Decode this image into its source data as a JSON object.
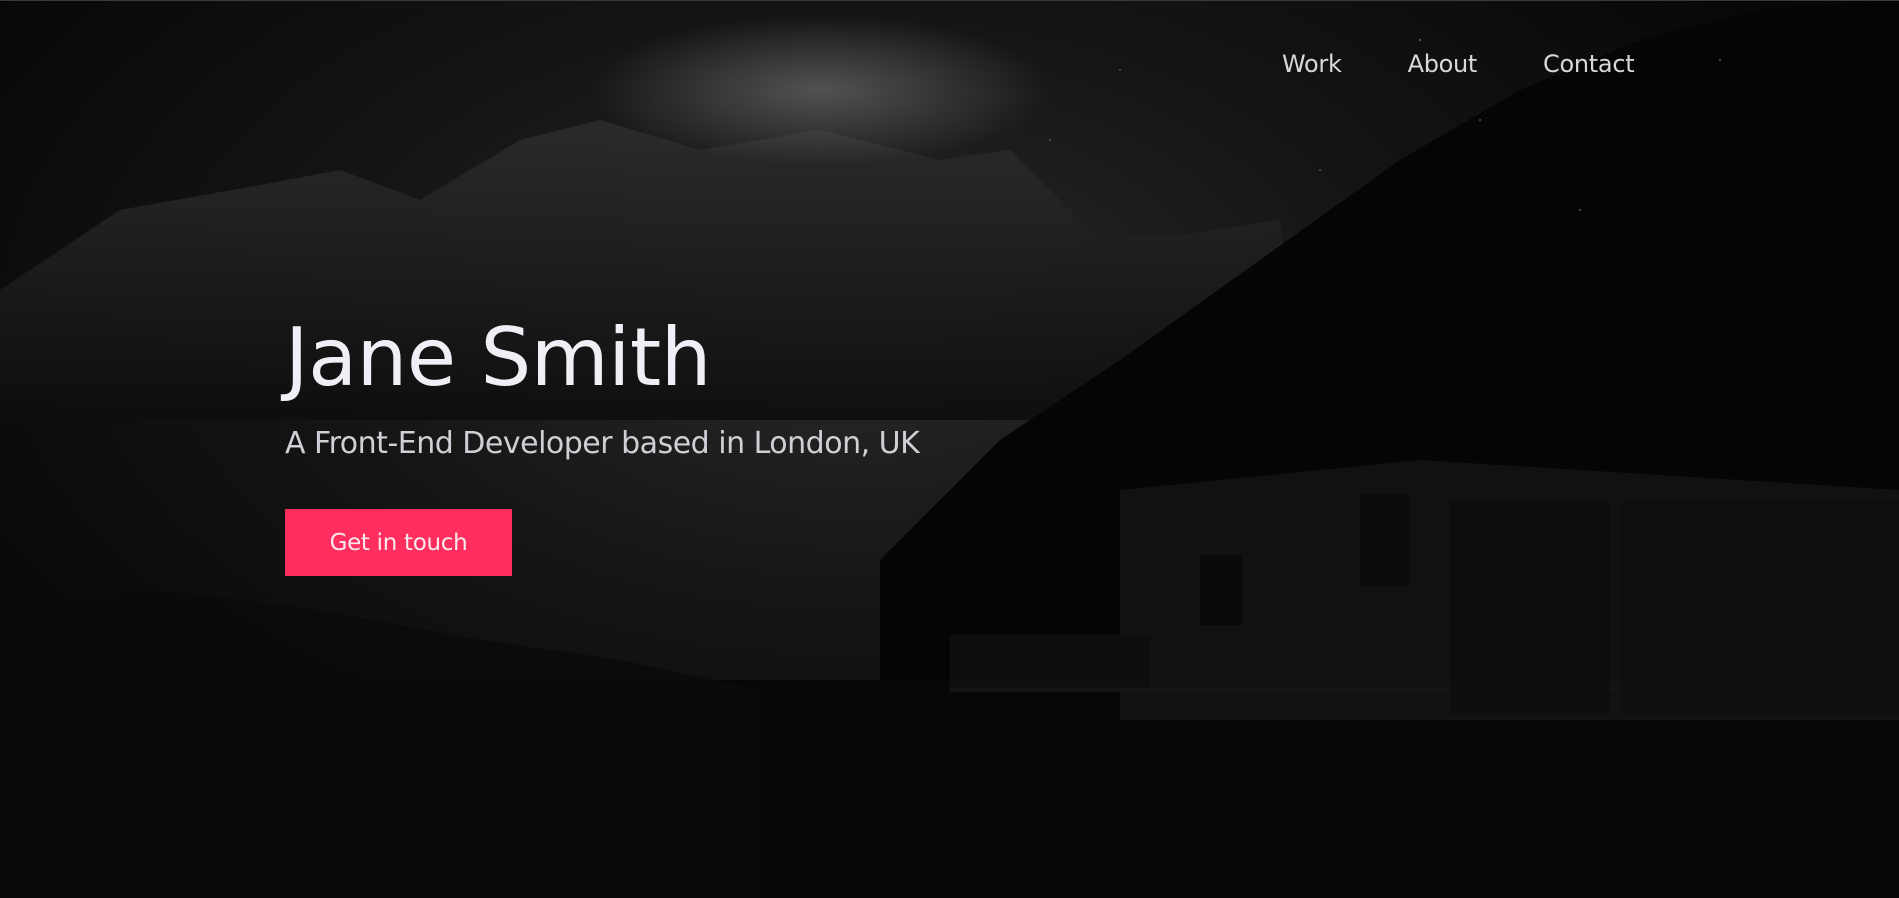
{
  "nav": {
    "items": [
      {
        "label": "Work"
      },
      {
        "label": "About"
      },
      {
        "label": "Contact"
      }
    ]
  },
  "hero": {
    "name": "Jane Smith",
    "tagline": "A Front-End Developer based in London, UK",
    "cta_label": "Get in touch"
  },
  "colors": {
    "accent": "#ff2e5e",
    "background": "#050505",
    "text": "#f2eef6"
  }
}
